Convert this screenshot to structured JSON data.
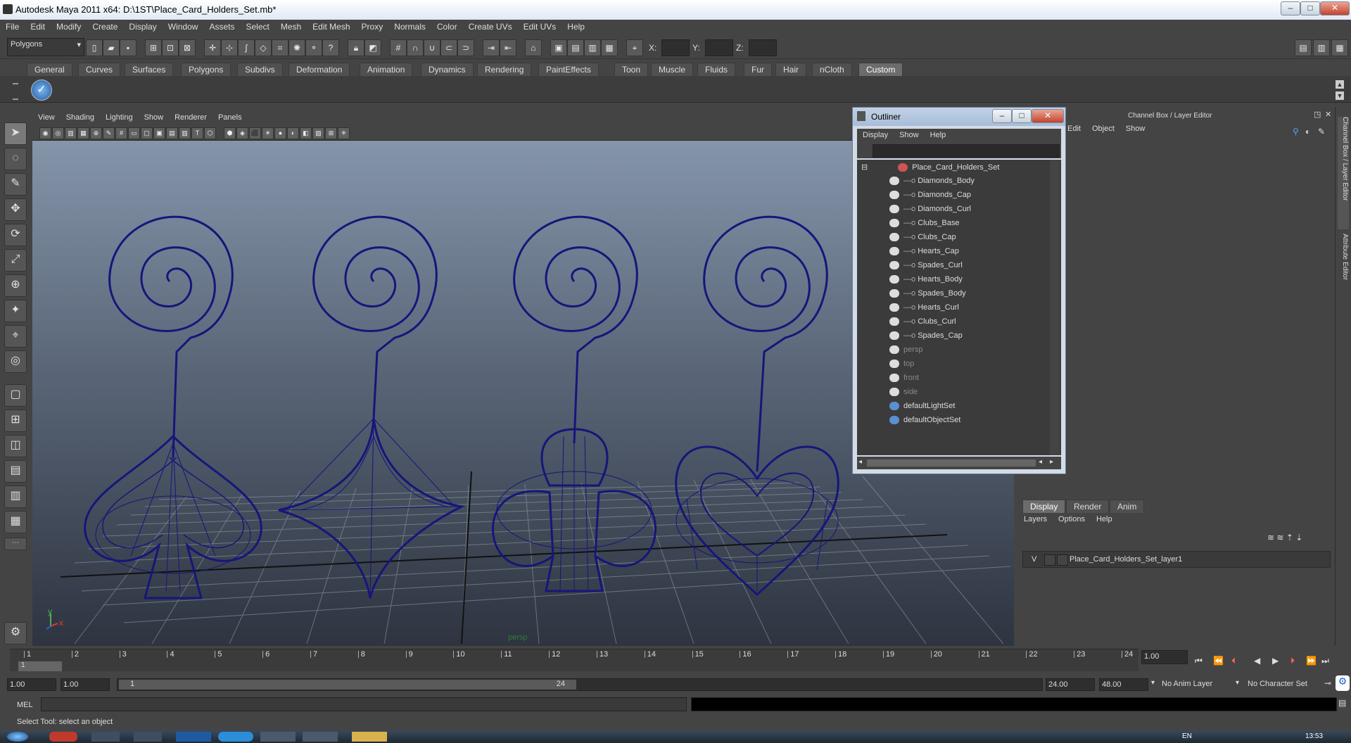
{
  "window": {
    "title": "Autodesk Maya 2011 x64: D:\\1ST\\Place_Card_Holders_Set.mb*",
    "minimize": "–",
    "maximize": "□",
    "close": "✕"
  },
  "menubar": [
    "File",
    "Edit",
    "Modify",
    "Create",
    "Display",
    "Window",
    "Assets",
    "Select",
    "Mesh",
    "Edit Mesh",
    "Proxy",
    "Normals",
    "Color",
    "Create UVs",
    "Edit UVs",
    "Help"
  ],
  "statusline": {
    "mode_selected": "Polygons",
    "x_label": "X:",
    "y_label": "Y:",
    "z_label": "Z:"
  },
  "shelf_tabs": [
    "General",
    "Curves",
    "Surfaces",
    "Polygons",
    "Subdivs",
    "Deformation",
    "Animation",
    "Dynamics",
    "Rendering",
    "PaintEffects",
    "Toon",
    "Muscle",
    "Fluids",
    "Fur",
    "Hair",
    "nCloth",
    "Custom"
  ],
  "shelf_active": "Custom",
  "viewport": {
    "menus": [
      "View",
      "Shading",
      "Lighting",
      "Show",
      "Renderer",
      "Panels"
    ],
    "camera_label": "persp",
    "axis_x": "x",
    "axis_y": "y"
  },
  "outliner": {
    "title": "Outliner",
    "menus": [
      "Display",
      "Show",
      "Help"
    ],
    "root": "Place_Card_Holders_Set",
    "children": [
      "Diamonds_Body",
      "Diamonds_Cap",
      "Diamonds_Curl",
      "Clubs_Base",
      "Clubs_Cap",
      "Hearts_Cap",
      "Spades_Curl",
      "Hearts_Body",
      "Spades_Body",
      "Hearts_Curl",
      "Clubs_Curl",
      "Spades_Cap"
    ],
    "cameras": [
      "persp",
      "top",
      "front",
      "side"
    ],
    "sets": [
      "defaultLightSet",
      "defaultObjectSet"
    ]
  },
  "channelbox": {
    "title": "Channel Box / Layer Editor",
    "menus": [
      "Edit",
      "Object",
      "Show"
    ]
  },
  "layereditor": {
    "tabs": [
      "Display",
      "Render",
      "Anim"
    ],
    "menus": [
      "Layers",
      "Options",
      "Help"
    ],
    "layer_visible": "V",
    "layer_name": "Place_Card_Holders_Set_layer1"
  },
  "rightstrip": {
    "tab1": "Channel Box / Layer Editor",
    "tab2": "Attribute Editor"
  },
  "timeslider": {
    "ticks": [
      "1",
      "2",
      "3",
      "4",
      "5",
      "6",
      "7",
      "8",
      "9",
      "10",
      "11",
      "12",
      "13",
      "14",
      "15",
      "16",
      "17",
      "18",
      "19",
      "20",
      "21",
      "22",
      "23",
      "24"
    ],
    "current_frame_marker": "1",
    "current_time": "1.00"
  },
  "rangeslider": {
    "start_time": "1.00",
    "playback_start": "1.00",
    "range_start_label": "1",
    "range_end_label": "24",
    "playback_end": "24.00",
    "end_time": "48.00",
    "anim_layer": "No Anim Layer",
    "character_set": "No Character Set"
  },
  "cmdline": {
    "label": "MEL"
  },
  "helpline": {
    "text": "Select Tool: select an object"
  },
  "taskbar": {
    "lang": "EN",
    "clock": "13:53"
  }
}
